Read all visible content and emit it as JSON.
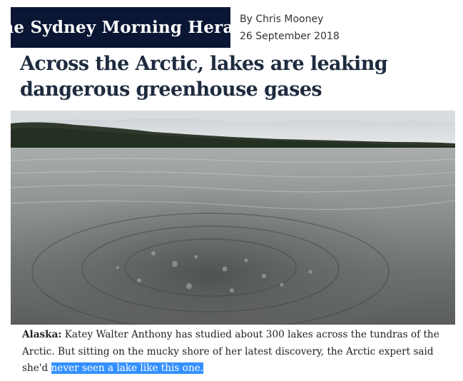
{
  "masthead": {
    "title": "The Sydney Morning Herald"
  },
  "article": {
    "author": "By Chris Mooney",
    "date": "26 September 2018",
    "headline": "Across the Arctic, lakes are leaking dangerous greenhouse gases"
  },
  "caption": {
    "place": "Alaska:",
    "text": " Katey Walter Anthony has studied about 300 lakes across the tundras of the Arctic. But sitting on the mucky shore of her latest discovery, the Arctic expert said she'd ",
    "highlighted": "never seen a lake like this one."
  },
  "colors": {
    "masthead_bg": "#0a1633",
    "headline": "#1e2b3f",
    "selection": "#3390ff"
  }
}
